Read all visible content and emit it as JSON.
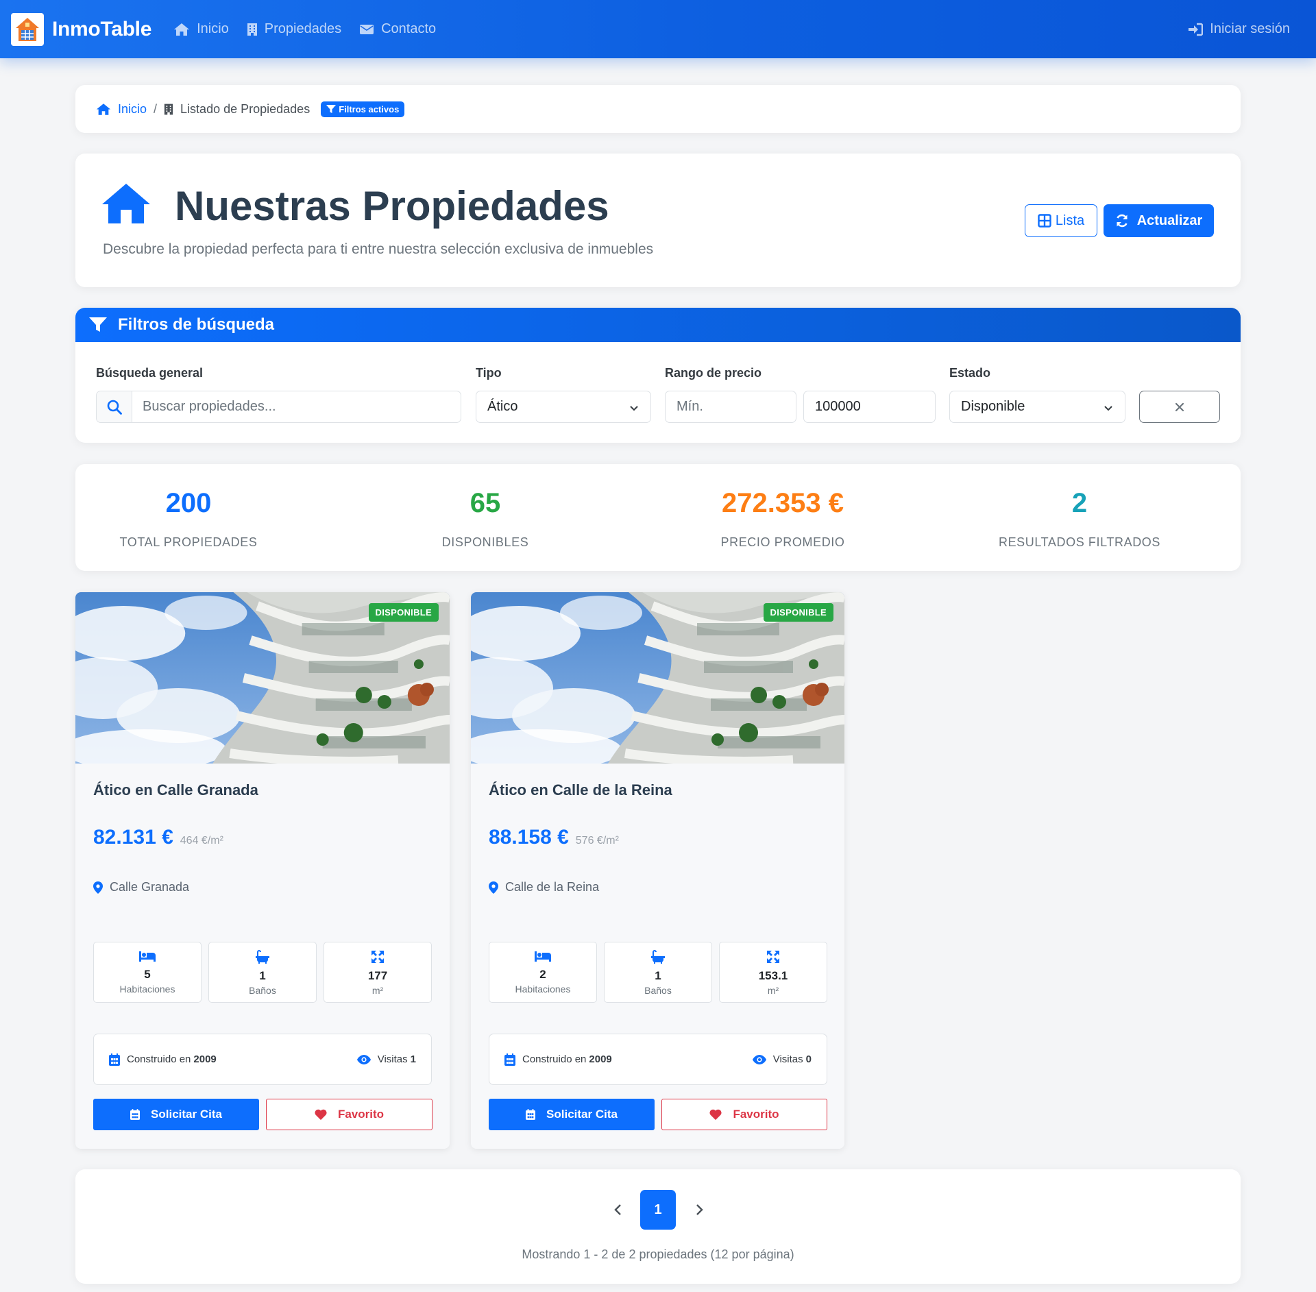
{
  "nav": {
    "brand": "InmoTable",
    "links": [
      {
        "label": "Inicio",
        "icon": "home-icon"
      },
      {
        "label": "Propiedades",
        "icon": "building-icon"
      },
      {
        "label": "Contacto",
        "icon": "envelope-icon"
      }
    ],
    "login": "Iniciar sesión"
  },
  "breadcrumb": {
    "home": "Inicio",
    "separator": "/",
    "current": "Listado de Propiedades",
    "badge": "Filtros activos"
  },
  "header": {
    "title": "Nuestras Propiedades",
    "subtitle": "Descubre la propiedad perfecta para ti entre nuestra selección exclusiva de inmuebles",
    "list_button": "Lista",
    "refresh_button": "Actualizar"
  },
  "filters": {
    "title": "Filtros de búsqueda",
    "search_label": "Búsqueda general",
    "search_placeholder": "Buscar propiedades...",
    "type_label": "Tipo",
    "type_value": "Ático",
    "price_label": "Rango de precio",
    "price_min_placeholder": "Mín.",
    "price_max_value": "100000",
    "status_label": "Estado",
    "status_value": "Disponible",
    "clear_symbol": "✕"
  },
  "stats": [
    {
      "value": "200",
      "label": "TOTAL PROPIEDADES",
      "color": "#0d6efd"
    },
    {
      "value": "65",
      "label": "DISPONIBLES",
      "color": "#28a745"
    },
    {
      "value": "272.353 €",
      "label": "PRECIO PROMEDIO",
      "color": "#fd7e14"
    },
    {
      "value": "2",
      "label": "RESULTADOS FILTRADOS",
      "color": "#17a2b8"
    }
  ],
  "properties": [
    {
      "badge": "DISPONIBLE",
      "title": "Ático en Calle Granada",
      "price": "82.131 €",
      "price_per_m2": "464 €/m²",
      "location": "Calle Granada",
      "rooms": "5",
      "rooms_label": "Habitaciones",
      "baths": "1",
      "baths_label": "Baños",
      "area": "177",
      "area_label": "m²",
      "built_label": "Construido en",
      "built_year": "2009",
      "visits_label": "Visitas",
      "visits": "1",
      "cita_button": "Solicitar Cita",
      "fav_button": "Favorito"
    },
    {
      "badge": "DISPONIBLE",
      "title": "Ático en Calle de la Reina",
      "price": "88.158 €",
      "price_per_m2": "576 €/m²",
      "location": "Calle de la Reina",
      "rooms": "2",
      "rooms_label": "Habitaciones",
      "baths": "1",
      "baths_label": "Baños",
      "area": "153.1",
      "area_label": "m²",
      "built_label": "Construido en",
      "built_year": "2009",
      "visits_label": "Visitas",
      "visits": "0",
      "cita_button": "Solicitar Cita",
      "fav_button": "Favorito"
    }
  ],
  "pagination": {
    "current_page": "1",
    "info": "Mostrando 1 - 2 de 2 propiedades (12 por página)"
  },
  "colors": {
    "primary": "#0d6efd",
    "success": "#28a745",
    "warning": "#fd7e14",
    "info": "#17a2b8",
    "danger": "#dc3545"
  }
}
